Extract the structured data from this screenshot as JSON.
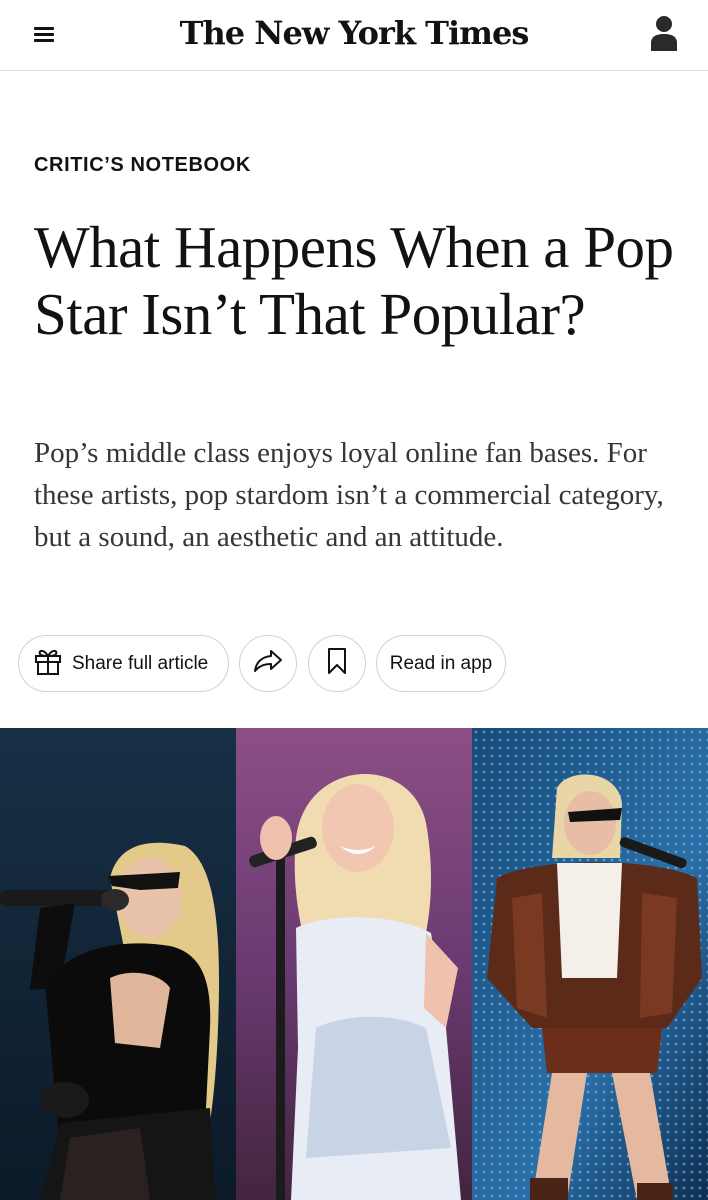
{
  "header": {
    "masthead": "The New York Times",
    "menu_icon": "hamburger-menu-icon",
    "account_icon": "user-account-icon"
  },
  "article": {
    "kicker": "CRITIC’S NOTEBOOK",
    "headline": "What Happens When a Pop Star Isn’t That Popular?",
    "summary": "Pop’s middle class enjoys loyal online fan bases. For these artists, pop stardom isn’t a commercial category, but a sound, an aesthetic and an attitude."
  },
  "actions": {
    "share_full_article": "Share full article",
    "gift_icon": "gift-icon",
    "share_icon": "share-arrow-icon",
    "save_icon": "bookmark-icon",
    "read_in_app": "Read in app"
  },
  "colors": {
    "text": "#121212",
    "summary_text": "#363636",
    "border": "#d0d0d0",
    "divider": "#dcdcdc"
  }
}
